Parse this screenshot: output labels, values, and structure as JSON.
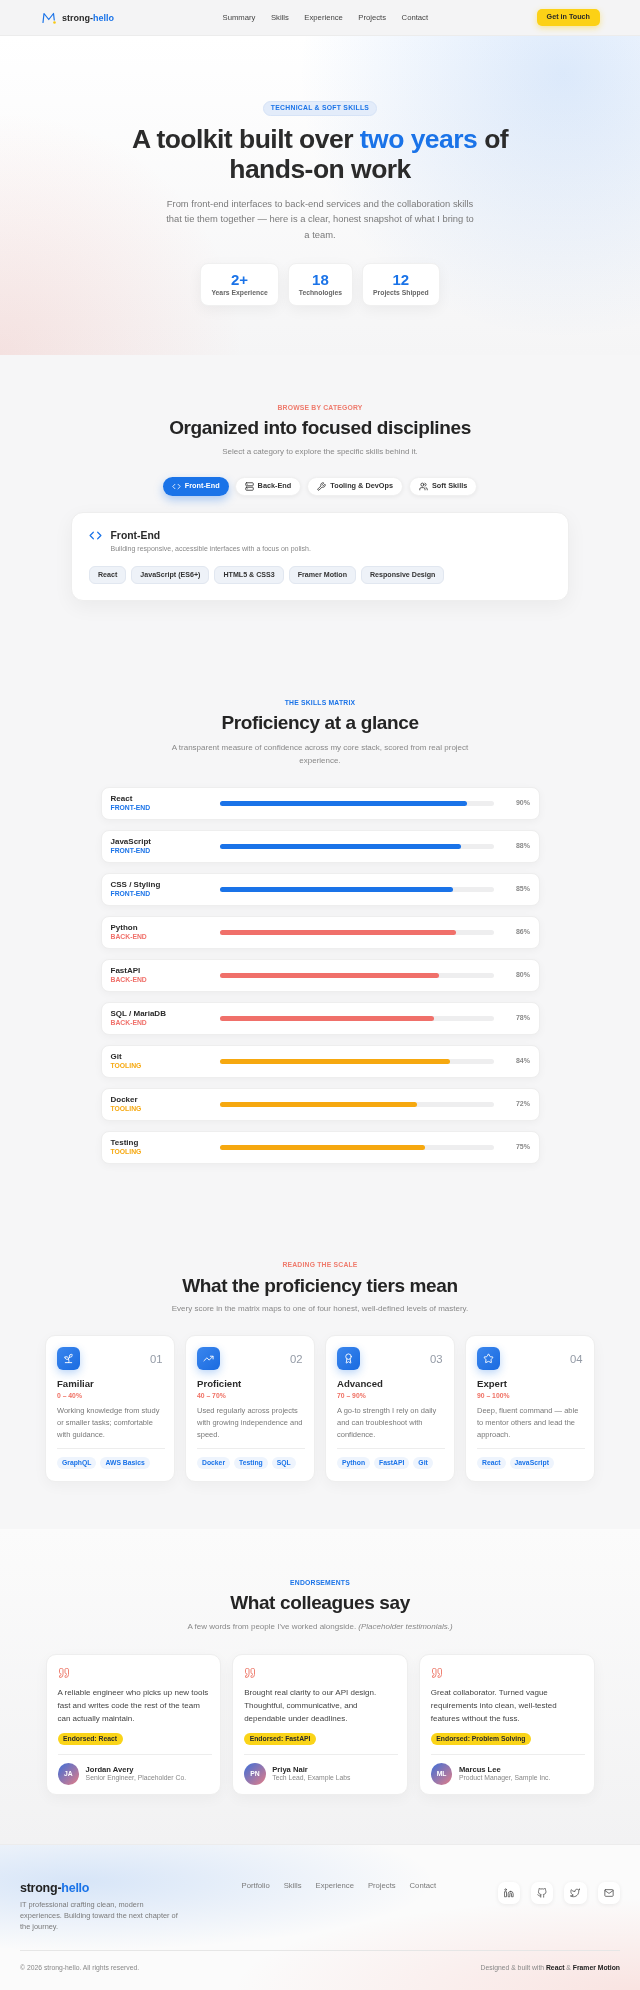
{
  "nav": {
    "logo_name": "strong-",
    "logo_accent": "hello",
    "links": [
      "Summary",
      "Skills",
      "Experience",
      "Projects",
      "Contact"
    ],
    "cta": "Get in Touch"
  },
  "hero": {
    "badge": "TECHNICAL & SOFT SKILLS",
    "heading": {
      "before": "A toolkit built over",
      "highlight": "two years",
      "after": "of hands-on work"
    },
    "subtitle": "From front-end interfaces to back-end services and the collaboration skills that tie them together — here is a clear, honest snapshot of what I bring to a team.",
    "stats": [
      {
        "value": "2+",
        "label": "Years Experience"
      },
      {
        "value": "18",
        "label": "Technologies"
      },
      {
        "value": "12",
        "label": "Projects Shipped"
      }
    ]
  },
  "categories": {
    "eyebrow": "BROWSE BY CATEGORY",
    "heading": "Organized into focused disciplines",
    "subtitle": "Select a category to explore the specific skills behind it.",
    "tabs": [
      {
        "label": "Front-End",
        "selected": true
      },
      {
        "label": "Back-End",
        "selected": false
      },
      {
        "label": "Tooling & DevOps",
        "selected": false
      },
      {
        "label": "Soft Skills",
        "selected": false
      }
    ],
    "panel": {
      "title": "Front-End",
      "description": "Building responsive, accessible interfaces with a focus on polish.",
      "skills": [
        "React",
        "JavaScript (ES6+)",
        "HTML5 & CSS3",
        "Framer Motion",
        "Responsive Design"
      ]
    }
  },
  "matrix": {
    "eyebrow": "THE SKILLS MATRIX",
    "heading": "Proficiency at a glance",
    "subtitle": "A transparent measure of confidence across my core stack, scored from real project experience.",
    "rows": [
      {
        "name": "React",
        "category": "FRONT-END",
        "color": "#1a73e8",
        "level": 0.9,
        "reading": "90%"
      },
      {
        "name": "JavaScript",
        "category": "FRONT-END",
        "color": "#1a73e8",
        "level": 0.88,
        "reading": "88%"
      },
      {
        "name": "CSS / Styling",
        "category": "FRONT-END",
        "color": "#1a73e8",
        "level": 0.85,
        "reading": "85%"
      },
      {
        "name": "Python",
        "category": "BACK-END",
        "color": "#f0706a",
        "level": 0.86,
        "reading": "86%"
      },
      {
        "name": "FastAPI",
        "category": "BACK-END",
        "color": "#f0706a",
        "level": 0.8,
        "reading": "80%"
      },
      {
        "name": "SQL / MariaDB",
        "category": "BACK-END",
        "color": "#f0706a",
        "level": 0.78,
        "reading": "78%"
      },
      {
        "name": "Git",
        "category": "TOOLING",
        "color": "#f6a80f",
        "level": 0.84,
        "reading": "84%"
      },
      {
        "name": "Docker",
        "category": "TOOLING",
        "color": "#f6a80f",
        "level": 0.72,
        "reading": "72%"
      },
      {
        "name": "Testing",
        "category": "TOOLING",
        "color": "#f6a80f",
        "level": 0.75,
        "reading": "75%"
      }
    ]
  },
  "tiers": {
    "eyebrow": "READING THE SCALE",
    "heading": "What the proficiency tiers mean",
    "subtitle": "Every score in the matrix maps to one of four honest, well-defined levels of mastery.",
    "cards": [
      {
        "number": "01",
        "title": "Familiar",
        "range": "0 – 40%",
        "description": "Working knowledge from study or smaller tasks; comfortable with guidance.",
        "skills": [
          "GraphQL",
          "AWS Basics"
        ]
      },
      {
        "number": "02",
        "title": "Proficient",
        "range": "40 – 70%",
        "description": "Used regularly across projects with growing independence and speed.",
        "skills": [
          "Docker",
          "Testing",
          "SQL"
        ]
      },
      {
        "number": "03",
        "title": "Advanced",
        "range": "70 – 90%",
        "description": "A go-to strength I rely on daily and can troubleshoot with confidence.",
        "skills": [
          "Python",
          "FastAPI",
          "Git"
        ]
      },
      {
        "number": "04",
        "title": "Expert",
        "range": "90 – 100%",
        "description": "Deep, fluent command — able to mentor others and lead the approach.",
        "skills": [
          "React",
          "JavaScript"
        ]
      }
    ]
  },
  "testimonials": {
    "eyebrow": "ENDORSEMENTS",
    "heading": "What colleagues say",
    "subtitle": "A few words from people I've worked alongside. *(Placeholder testimonials.)*",
    "cards": [
      {
        "quote": "A reliable engineer who picks up new tools fast and writes code the rest of the team can actually maintain.",
        "endorsement": "Endorsed: React",
        "initials": "JA",
        "name": "Jordan Avery",
        "role": "Senior Engineer, Placeholder Co."
      },
      {
        "quote": "Brought real clarity to our API design. Thoughtful, communicative, and dependable under deadlines.",
        "endorsement": "Endorsed: FastAPI",
        "initials": "PN",
        "name": "Priya Nair",
        "role": "Tech Lead, Example Labs"
      },
      {
        "quote": "Great collaborator. Turned vague requirements into clean, well-tested features without the fuss.",
        "endorsement": "Endorsed: Problem Solving",
        "initials": "ML",
        "name": "Marcus Lee",
        "role": "Product Manager, Sample Inc."
      }
    ]
  },
  "footer": {
    "logo_name": "strong-",
    "logo_accent": "hello",
    "description": "IT professional crafting clean, modern experiences. Building toward the next chapter of the journey.",
    "links": [
      "Portfolio",
      "Skills",
      "Experience",
      "Projects",
      "Contact"
    ],
    "copyright": "© 2026 strong-hello. All rights reserved.",
    "credit": "Designed & built with **React** & **Framer Motion**"
  }
}
